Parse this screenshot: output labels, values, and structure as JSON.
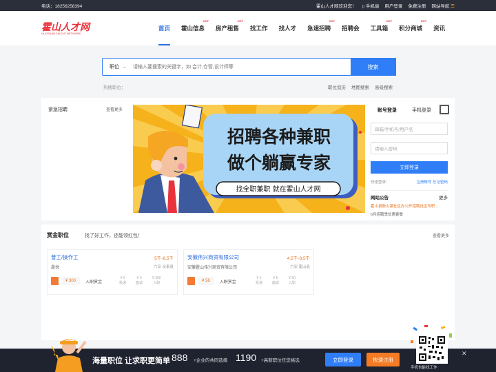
{
  "topbar": {
    "phone": "电话：18256258394",
    "welcome": "霍山人才网欢迎您！",
    "mobile": "手机端",
    "login": "用户登录",
    "register": "免费注册",
    "sitenav": "网站导航"
  },
  "logo": {
    "text": "霍山人才网",
    "sub": "HUOSHAN TALENT NETWORK"
  },
  "nav": [
    {
      "label": "首页",
      "hot": ""
    },
    {
      "label": "霍山信息",
      "hot": "HOT"
    },
    {
      "label": "房产租售",
      "hot": "HOT"
    },
    {
      "label": "找工作",
      "hot": ""
    },
    {
      "label": "找人才",
      "hot": ""
    },
    {
      "label": "急速招聘",
      "hot": "HOT"
    },
    {
      "label": "招聘会",
      "hot": ""
    },
    {
      "label": "工具箱",
      "hot": "HOT"
    },
    {
      "label": "积分商城",
      "hot": "HOT"
    },
    {
      "label": "资讯",
      "hot": ""
    }
  ],
  "search": {
    "category": "职位",
    "placeholder": "请输入要搜索的关键字，如 会计,仓管,设计师等",
    "button": "搜索",
    "hot_label": "热搜职位：",
    "links": [
      "职位追历",
      "地图搜索",
      "高级搜索"
    ]
  },
  "urgent": {
    "title": "紧急招聘",
    "more": "查看更多"
  },
  "banner": {
    "line1": "招聘各种兼职",
    "line2": "做个躺赢专家",
    "tag": "找全职兼职 就在霍山人才网"
  },
  "login": {
    "tab_account": "账号登录",
    "tab_mobile": "手机登录",
    "user_placeholder": "邮箱/手机号/用户名",
    "pass_placeholder": "请输入密码",
    "button": "立即登录",
    "quick": "快速登录：",
    "register": "注册账号",
    "forgot": "忘记密码",
    "notice_title": "网站公告",
    "notice_more": "更多",
    "notice1": "霍山县衡山镇社区办公开招聘社区专职...",
    "notice2": "6月招聘季优惠套餐"
  },
  "bounty": {
    "title": "赏金职位",
    "sub": "找了好工作，还能领红包！",
    "more": "查看更多",
    "cards": [
      {
        "name": "普工/操作工",
        "salary": "5千-6.5千",
        "company": "晨悦",
        "location": "六安 佘事县",
        "amount": "¥ 300",
        "label": "入职赏金",
        "s1n": "¥ 0",
        "s1l": "投递",
        "s2n": "¥ 0",
        "s2l": "面试",
        "s3n": "¥ 300",
        "s3l": "入职"
      },
      {
        "name": "安徽伟兴商贸有限公司",
        "salary": "4.5千-8.5千",
        "company": "安徽霍山伟兴商贸有限公司",
        "location": "六安 霍山县",
        "amount": "¥ 56",
        "label": "入职赏金",
        "s1n": "¥ 1",
        "s1l": "投递",
        "s2n": "¥ 5",
        "s2l": "面试",
        "s3n": "¥ 50",
        "s3l": "入职"
      }
    ]
  },
  "footer": {
    "slogan": "海量职位 让求职更简单",
    "num1": "888",
    "desc1": "+企业的共同选择",
    "num2": "1190",
    "desc2": "+高薪职位任您挑选",
    "login": "立即登录",
    "register": "快速注册",
    "qr_caption": "手机也能找工作"
  },
  "colors": {
    "primary": "#2f7ef7",
    "accent": "#f47a24",
    "brand": "#e8323c"
  }
}
